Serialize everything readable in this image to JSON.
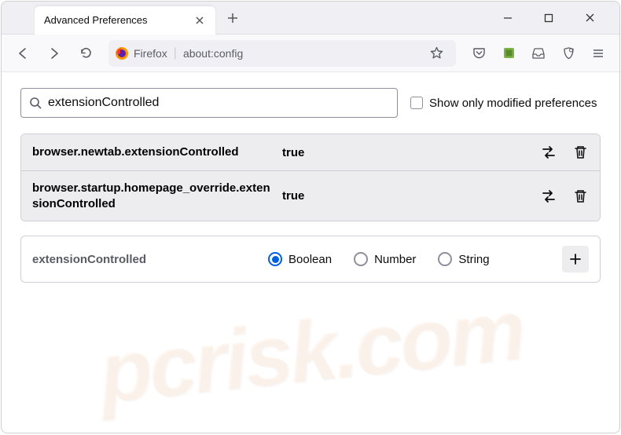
{
  "window": {
    "tab_title": "Advanced Preferences"
  },
  "navbar": {
    "identity_label": "Firefox",
    "url": "about:config"
  },
  "search": {
    "value": "extensionControlled",
    "checkbox_label": "Show only modified preferences"
  },
  "prefs": [
    {
      "name": "browser.newtab.extensionControlled",
      "value": "true"
    },
    {
      "name": "browser.startup.homepage_override.extensionControlled",
      "value": "true"
    }
  ],
  "newpref": {
    "name": "extensionControlled",
    "types": {
      "boolean": "Boolean",
      "number": "Number",
      "string": "String"
    }
  },
  "watermark": "pcrisk.com"
}
